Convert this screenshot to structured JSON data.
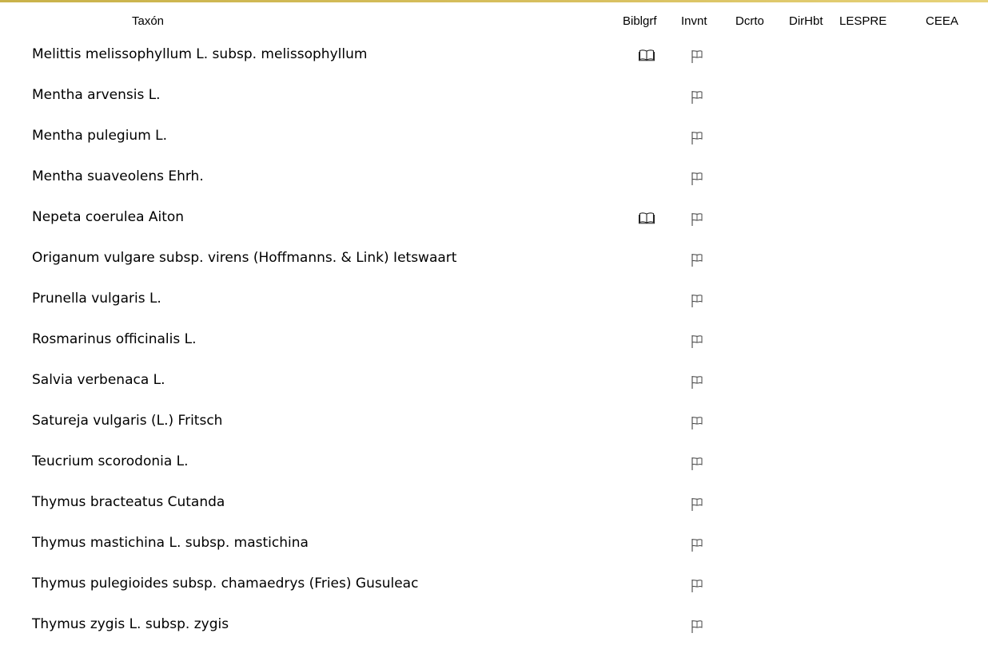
{
  "header": {
    "taxon": "Taxón",
    "biblgrf": "Biblgrf",
    "invnt": "Invnt",
    "dcrto": "Dcrto",
    "dirhbt": "DirHbt",
    "lespre": "LESPRE",
    "ceea": "CEEA"
  },
  "icons": {
    "bibliography": "open-book-icon",
    "inventory": "flag-icon"
  },
  "rows": [
    {
      "name": "Melittis melissophyllum L. subsp. melissophyllum",
      "biblgrf": true,
      "invnt": true
    },
    {
      "name": "Mentha arvensis L.",
      "biblgrf": false,
      "invnt": true
    },
    {
      "name": "Mentha pulegium L.",
      "biblgrf": false,
      "invnt": true
    },
    {
      "name": "Mentha suaveolens Ehrh.",
      "biblgrf": false,
      "invnt": true
    },
    {
      "name": "Nepeta coerulea Aiton",
      "biblgrf": true,
      "invnt": true
    },
    {
      "name": "Origanum vulgare subsp. virens (Hoffmanns. & Link) Ietswaart",
      "biblgrf": false,
      "invnt": true
    },
    {
      "name": "Prunella vulgaris L.",
      "biblgrf": false,
      "invnt": true
    },
    {
      "name": "Rosmarinus officinalis L.",
      "biblgrf": false,
      "invnt": true
    },
    {
      "name": "Salvia verbenaca L.",
      "biblgrf": false,
      "invnt": true
    },
    {
      "name": "Satureja vulgaris (L.) Fritsch",
      "biblgrf": false,
      "invnt": true
    },
    {
      "name": "Teucrium scorodonia L.",
      "biblgrf": false,
      "invnt": true
    },
    {
      "name": "Thymus bracteatus Cutanda",
      "biblgrf": false,
      "invnt": true
    },
    {
      "name": "Thymus mastichina L. subsp. mastichina",
      "biblgrf": false,
      "invnt": true
    },
    {
      "name": "Thymus pulegioides subsp. chamaedrys (Fries) Gusuleac",
      "biblgrf": false,
      "invnt": true
    },
    {
      "name": "Thymus zygis L. subsp. zygis",
      "biblgrf": false,
      "invnt": true
    }
  ]
}
